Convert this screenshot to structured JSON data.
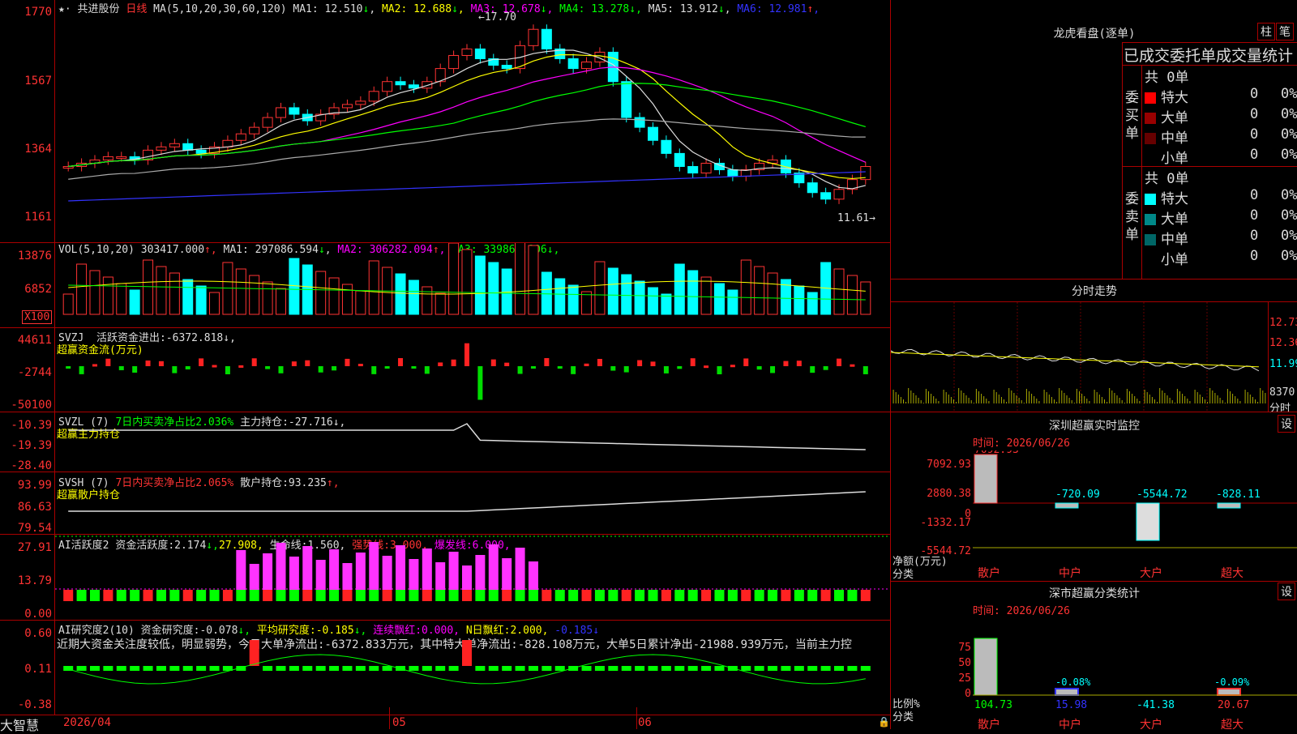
{
  "stock": {
    "name": "共进股份",
    "period": "日线"
  },
  "main_panel": {
    "ma_label": "MA(5,10,20,30,60,120)",
    "ma": [
      {
        "name": "MA1",
        "value": "12.510",
        "arrow": "↓",
        "color": "#dddddd"
      },
      {
        "name": "MA2",
        "value": "12.688",
        "arrow": "↓",
        "color": "#ffff00"
      },
      {
        "name": "MA3",
        "value": "12.678",
        "arrow": "↓",
        "color": "#ff00ff"
      },
      {
        "name": "MA4",
        "value": "13.278",
        "arrow": "↓",
        "color": "#00ff00"
      },
      {
        "name": "MA5",
        "value": "13.912",
        "arrow": "↓",
        "color": "#dddddd"
      },
      {
        "name": "MA6",
        "value": "12.981",
        "arrow": "↑",
        "color": "#3333ff"
      }
    ],
    "y_ticks": [
      "1770",
      "1567",
      "1364",
      "1161"
    ],
    "high_label": "17.70",
    "low_label": "11.61"
  },
  "vol_panel": {
    "label": "VOL(5,10,20)",
    "value": "303417.000",
    "ma": [
      {
        "name": "MA1",
        "value": "297086.594",
        "arrow": "↓",
        "color": "#dddddd"
      },
      {
        "name": "MA2",
        "value": "306282.094",
        "arrow": "↑",
        "color": "#ff00ff"
      },
      {
        "name": "MA3",
        "value": "339868.906",
        "arrow": "↓",
        "color": "#00ff00"
      }
    ],
    "y_ticks": [
      "13876",
      "6852"
    ],
    "unit": "X100"
  },
  "svzj": {
    "label": "SVZJ",
    "text1": "活跃资金进出:",
    "value": "-6372.818",
    "arrow": "↓,",
    "sub": "超赢资金流(万元)",
    "y_ticks": [
      "44611",
      "-2744",
      "-50100"
    ]
  },
  "svzl": {
    "label": "SVZL (7)",
    "text1": "7日内买卖净占比2.036%",
    "text2": "主力持仓:",
    "value": "-27.716",
    "arrow": "↓,",
    "sub": "超赢主力持仓",
    "y_ticks": [
      "-10.39",
      "-19.39",
      "-28.40"
    ]
  },
  "svsh": {
    "label": "SVSH (7)",
    "text1": "7日内买卖净占比2.065%",
    "text2": "散户持仓:",
    "value": "93.235",
    "arrow": "↑,",
    "sub": "超赢散户持仓",
    "y_ticks": [
      "93.99",
      "86.63",
      "79.54"
    ]
  },
  "ai1": {
    "label": "AI活跃度2",
    "t1": "资金活跃度:",
    "v1": "2.174",
    "a1": "↓,",
    "v2": "27.908,",
    "t3": "生命线:",
    "v3": "1.560,",
    "t4": "强势线:",
    "v4": "3.000,",
    "t5": "爆发线:",
    "v5": "6.000,",
    "y_ticks": [
      "27.91",
      "13.79",
      "0.00"
    ]
  },
  "ai2": {
    "label": "AI研究度2(10)",
    "t1": "资金研究度:",
    "v1": "-0.078",
    "a1": "↓,",
    "t2": "平均研究度:",
    "v2": "-0.185",
    "a2": "↓,",
    "t3": "连续飘红:",
    "v3": "0.000,",
    "t4": "N日飘红:",
    "v4": "2.000,",
    "v5": "-0.185",
    "a5": "↓",
    "note": "近期大资金关注度较低，明显弱势，今日大单净流出:-6372.833万元，其中特大单净流出:-828.108万元，大单5日累计净出-21988.939万元，当前主力控",
    "y_ticks": [
      "0.60",
      "0.11",
      "-0.38"
    ]
  },
  "x_axis": {
    "labels": [
      "2026/04",
      "05",
      "06"
    ],
    "brand": "大智慧"
  },
  "longhu": {
    "title": "龙虎看盘(逐单)",
    "btn1": "柱",
    "btn2": "笔",
    "subtitle": "已成交委托单成交量统计",
    "buy": {
      "vertical": "委买单",
      "total": "共 0单",
      "rows": [
        {
          "label": "特大",
          "v": "0",
          "p": "0%",
          "color": "#ff0000"
        },
        {
          "label": "大单",
          "v": "0",
          "p": "0%",
          "color": "#990000"
        },
        {
          "label": "中单",
          "v": "0",
          "p": "0%",
          "color": "#660000"
        },
        {
          "label": "小单",
          "v": "0",
          "p": "0%",
          "color": "#000000"
        }
      ]
    },
    "sell": {
      "vertical": "委卖单",
      "total": "共 0单",
      "rows": [
        {
          "label": "特大",
          "v": "0",
          "p": "0%",
          "color": "#00ffff"
        },
        {
          "label": "大单",
          "v": "0",
          "p": "0%",
          "color": "#008888"
        },
        {
          "label": "中单",
          "v": "0",
          "p": "0%",
          "color": "#006666"
        },
        {
          "label": "小单",
          "v": "0",
          "p": "0%",
          "color": "#000000"
        }
      ]
    }
  },
  "fenshi": {
    "title": "分时走势",
    "y_ticks": [
      "12.73",
      "12.36",
      "11.99",
      "8370"
    ],
    "unit": "分时"
  },
  "monitor": {
    "title": "深圳超赢实时监控",
    "btn": "设",
    "time": "时间: 2026/06/26",
    "y_ticks": [
      "7092.93",
      "2880.38",
      "0",
      "-1332.17",
      "-5544.72"
    ],
    "values": [
      "7092.93",
      "-720.09",
      "-5544.72",
      "-828.11"
    ],
    "ylabel": "净额(万元)",
    "xlabel": "分类",
    "cats": [
      "散户",
      "中户",
      "大户",
      "超大"
    ]
  },
  "classify": {
    "title": "深市超赢分类统计",
    "btn": "设",
    "time": "时间: 2026/06/26",
    "y_ticks": [
      "75",
      "50",
      "25",
      "0"
    ],
    "top_values": [
      "-0.08%",
      "-0.09%"
    ],
    "bottom_values": [
      "104.73",
      "15.98",
      "-41.38",
      "20.67"
    ],
    "ylabel": "比例%",
    "xlabel": "分类",
    "cats": [
      "散户",
      "中户",
      "大户",
      "超大"
    ]
  }
}
